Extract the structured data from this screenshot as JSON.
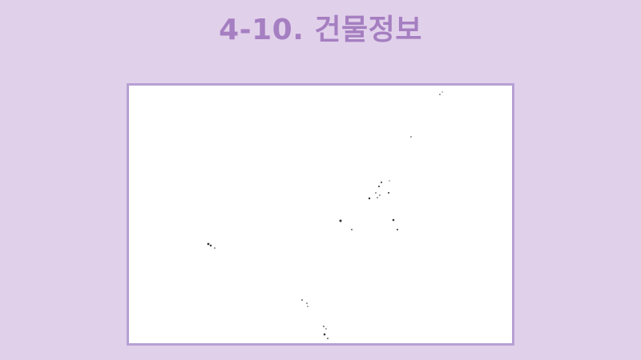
{
  "slide": {
    "title": "4-10. 건물정보"
  },
  "colors": {
    "background": "#e1d0ea",
    "title": "#a57fc1",
    "frame_border": "#b7a0d4",
    "map_background": "#ffffff",
    "marker": "#333333"
  }
}
